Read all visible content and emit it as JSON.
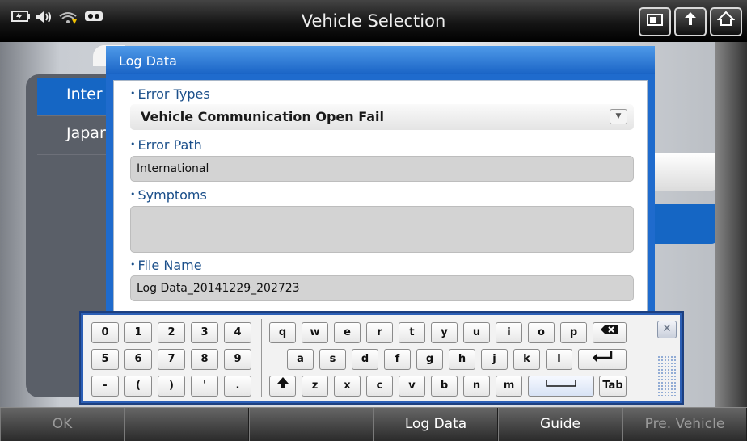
{
  "header": {
    "title": "Vehicle Selection",
    "status_icons": [
      "battery-icon",
      "volume-icon",
      "wifi-icon",
      "vci-icon"
    ],
    "buttons": [
      "screenshot-icon",
      "back-icon",
      "home-icon"
    ]
  },
  "background": {
    "list_items": [
      "Inter",
      "Japar"
    ]
  },
  "dialog": {
    "title": "Log Data",
    "error_types_label": "Error Types",
    "error_types_value": "Vehicle Communication Open Fail",
    "error_path_label": "Error Path",
    "error_path_value": "International",
    "symptoms_label": "Symptoms",
    "symptoms_value": "",
    "file_name_label": "File Name",
    "file_name_value": "Log Data_20141229_202723"
  },
  "keyboard": {
    "row1_num": [
      "0",
      "1",
      "2",
      "3",
      "4"
    ],
    "row2_num": [
      "5",
      "6",
      "7",
      "8",
      "9"
    ],
    "row3_num": [
      "-",
      "(",
      ")",
      "'",
      "."
    ],
    "row1": [
      "q",
      "w",
      "e",
      "r",
      "t",
      "y",
      "u",
      "i",
      "o",
      "p"
    ],
    "row2": [
      "a",
      "s",
      "d",
      "f",
      "g",
      "h",
      "j",
      "k",
      "l"
    ],
    "row3": [
      "z",
      "x",
      "c",
      "v",
      "b",
      "n",
      "m"
    ],
    "tab_label": "Tab"
  },
  "footer": {
    "buttons": [
      {
        "label": "OK",
        "enabled": false
      },
      {
        "label": "",
        "enabled": false
      },
      {
        "label": "",
        "enabled": false
      },
      {
        "label": "Log Data",
        "enabled": true
      },
      {
        "label": "Guide",
        "enabled": true
      },
      {
        "label": "Pre. Vehicle",
        "enabled": false
      }
    ]
  }
}
